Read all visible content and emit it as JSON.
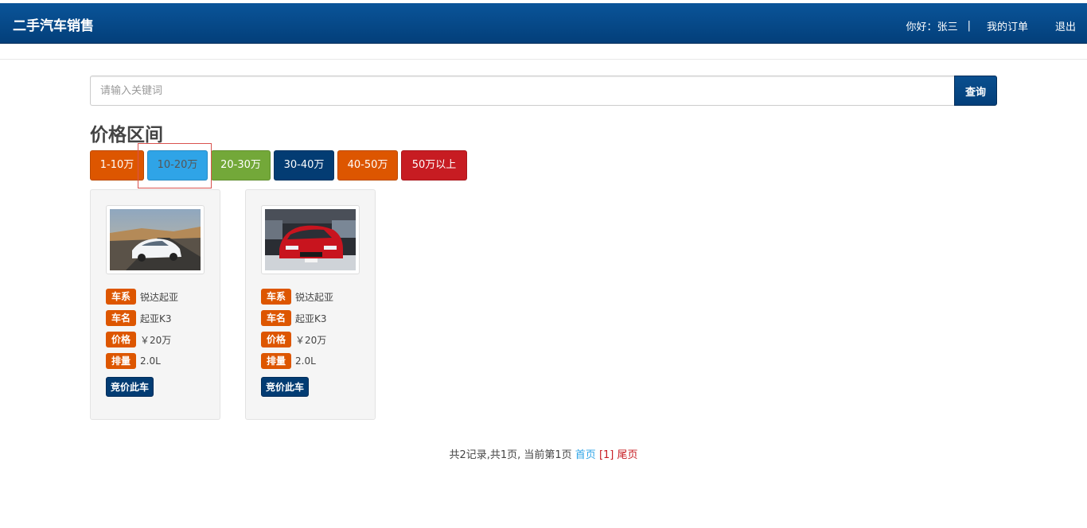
{
  "navbar": {
    "brand": "二手汽车销售",
    "greeting": "你好：",
    "username": "张三",
    "separator": "|",
    "my_orders": "我的订单",
    "logout": "退出"
  },
  "search": {
    "placeholder": "请输入关键词",
    "value": "",
    "button_label": "查询"
  },
  "price_section": {
    "title": "价格区间",
    "selected": "10-20万",
    "buttons": [
      {
        "label": "1-10万",
        "color": "#dd5600"
      },
      {
        "label": "10-20万",
        "color": "#2fa4e7",
        "text_color": "#555555"
      },
      {
        "label": "20-30万",
        "color": "#73a839"
      },
      {
        "label": "30-40万",
        "color": "#033c73"
      },
      {
        "label": "40-50万",
        "color": "#dd5600"
      },
      {
        "label": "50万以上",
        "color": "#c71c22"
      }
    ]
  },
  "cars": [
    {
      "image_icon": "white-sedan-desert-photo",
      "series_label": "车系",
      "series": "锐达起亚",
      "name_label": "车名",
      "name": "起亚K3",
      "price_label": "价格",
      "price": "￥20万",
      "displacement_label": "排量",
      "displacement": "2.0L",
      "bid_label": "竞价此车"
    },
    {
      "image_icon": "red-car-showroom-photo",
      "series_label": "车系",
      "series": "锐达起亚",
      "name_label": "车名",
      "name": "起亚K3",
      "price_label": "价格",
      "price": "￥20万",
      "displacement_label": "排量",
      "displacement": "2.0L",
      "bid_label": "竞价此车"
    }
  ],
  "pagination": {
    "summary": "共2记录,共1页, 当前第1页 ",
    "first": "首页",
    "current": "[1]",
    "last": "尾页"
  },
  "colors": {
    "navbar": "#033f7a",
    "tag": "#dd5600",
    "bid_button": "#033c73",
    "link": "#2fa4e7",
    "link_red": "#c71c22"
  }
}
